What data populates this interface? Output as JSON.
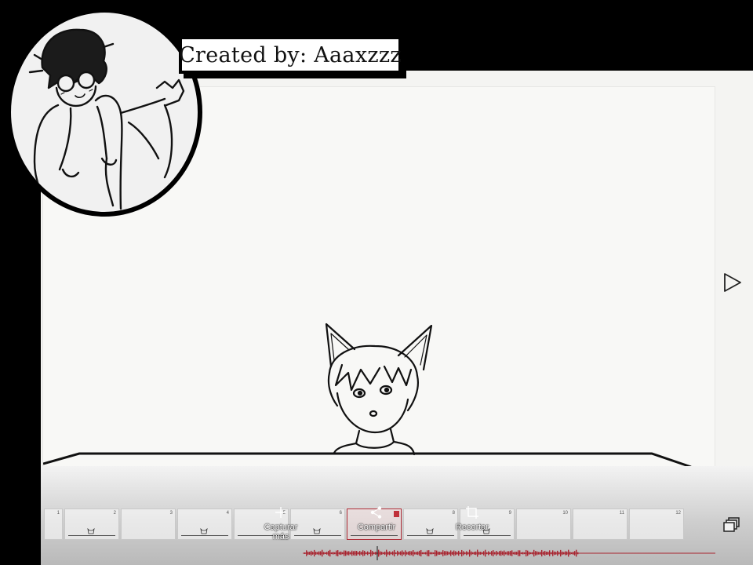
{
  "credit": {
    "text": "Created by: Aaaxzzz"
  },
  "toolbar": {
    "capture_label_line1": "Capturar",
    "capture_label_line2": "más",
    "share_label": "Compartir",
    "crop_label": "Recortar"
  },
  "timeline": {
    "frames": [
      {
        "num": "1"
      },
      {
        "num": "2"
      },
      {
        "num": "3"
      },
      {
        "num": "4"
      },
      {
        "num": "5"
      },
      {
        "num": "6"
      },
      {
        "num": "7"
      },
      {
        "num": "8"
      },
      {
        "num": "9"
      },
      {
        "num": "10"
      },
      {
        "num": "11"
      },
      {
        "num": "12"
      }
    ],
    "selected_frame": "7"
  },
  "icons": {
    "play": "play-icon",
    "capture": "plus-icon",
    "share": "share-icon",
    "crop": "crop-icon",
    "layers": "layers-icon"
  },
  "colors": {
    "accent": "#b0303a",
    "waveform": "#a8232e"
  }
}
